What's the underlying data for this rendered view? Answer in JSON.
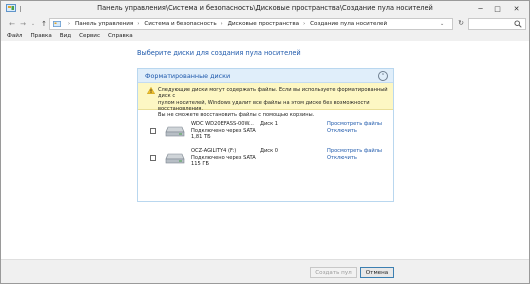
{
  "window": {
    "title": "Панель управления\\Система и безопасность\\Дисковые пространства\\Создание пула носителей",
    "minimize_glyph": "─",
    "maximize_glyph": "□",
    "close_glyph": "✕"
  },
  "toolbar": {
    "back_glyph": "←",
    "forward_glyph": "→",
    "recent_glyph": "⌄",
    "up_glyph": "↑",
    "breadcrumb": [
      "Панель управления",
      "Система и безопасность",
      "Дисковые пространства",
      "Создание пула носителей"
    ],
    "breadcrumb_separator": "›",
    "address_dropdown_glyph": "⌄",
    "refresh_glyph": "↻"
  },
  "menu": [
    "Файл",
    "Правка",
    "Вид",
    "Сервис",
    "Справка"
  ],
  "main": {
    "heading": "Выберите диски для создания пула носителей",
    "panel": {
      "title": "Форматированные диски",
      "collapse_glyph": "⌃",
      "warning": "Следующие диски могут содержать файлы. Если вы используете форматированный диск с\nпулом носителей, Windows удалит все файлы на этом диске без возможности восстановления.\nВы не сможете восстановить файлы с помощью корзины."
    },
    "disks": [
      {
        "checked": false,
        "name": "WDC WD20EFASS-00W...",
        "connection": "Подключено через SATA",
        "size": "1,81 ТБ",
        "disk_number": "Диск 1",
        "view_files": "Просмотреть файлы",
        "disconnect": "Отключить"
      },
      {
        "checked": false,
        "name": "OCZ-AGILITY4 (F:)",
        "connection": "Подключено через SATA",
        "size": "115 ГБ",
        "disk_number": "Диск 0",
        "view_files": "Просмотреть файлы",
        "disconnect": "Отключить"
      }
    ]
  },
  "footer": {
    "create_label": "Создать пул",
    "cancel_label": "Отмена"
  },
  "icons": {
    "app": "control-panel-icon",
    "warning": "warning-icon",
    "drive": "hard-drive-icon",
    "search": "search-icon"
  },
  "colors": {
    "link": "#1d58ab",
    "warning_bg": "#fdf7c3",
    "panel_header_bg": "#e0eefa"
  }
}
